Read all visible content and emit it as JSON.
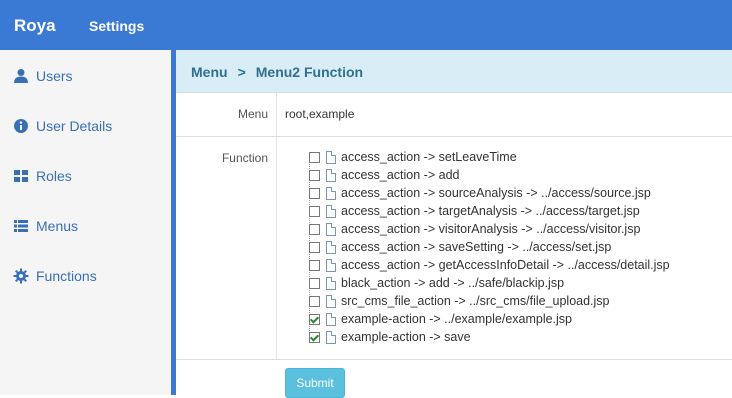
{
  "header": {
    "brand": "Roya",
    "nav_settings": "Settings",
    "bg_color": "#3a7ad5"
  },
  "sidebar": {
    "items": [
      {
        "label": "Users",
        "icon": "user-icon"
      },
      {
        "label": "User Details",
        "icon": "info-icon"
      },
      {
        "label": "Roles",
        "icon": "grid-icon"
      },
      {
        "label": "Menus",
        "icon": "list-icon"
      },
      {
        "label": "Functions",
        "icon": "gear-icon"
      }
    ]
  },
  "breadcrumb": {
    "parent": "Menu",
    "separator": ">",
    "current": "Menu2 Function"
  },
  "form": {
    "menu_label": "Menu",
    "menu_value": "root,example",
    "function_label": "Function",
    "functions": [
      {
        "label": "access_action -> setLeaveTime",
        "checked": false
      },
      {
        "label": "access_action -> add",
        "checked": false
      },
      {
        "label": "access_action -> sourceAnalysis -> ../access/source.jsp",
        "checked": false
      },
      {
        "label": "access_action -> targetAnalysis -> ../access/target.jsp",
        "checked": false
      },
      {
        "label": "access_action -> visitorAnalysis -> ../access/visitor.jsp",
        "checked": false
      },
      {
        "label": "access_action -> saveSetting -> ../access/set.jsp",
        "checked": false
      },
      {
        "label": "access_action -> getAccessInfoDetail -> ../access/detail.jsp",
        "checked": false
      },
      {
        "label": "black_action -> add -> ../safe/blackip.jsp",
        "checked": false
      },
      {
        "label": "src_cms_file_action -> ../src_cms/file_upload.jsp",
        "checked": false
      },
      {
        "label": "example-action -> ../example/example.jsp",
        "checked": true
      },
      {
        "label": "example-action -> save",
        "checked": true
      }
    ],
    "submit_label": "Submit"
  }
}
